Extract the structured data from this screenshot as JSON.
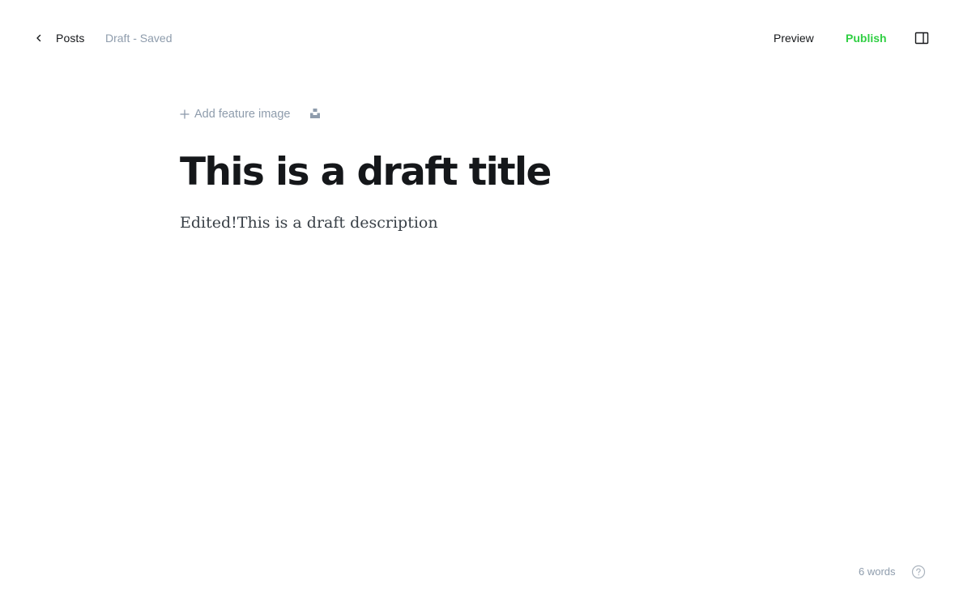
{
  "header": {
    "back_label": "Posts",
    "status": "Draft - Saved",
    "preview_label": "Preview",
    "publish_label": "Publish"
  },
  "editor": {
    "add_feature_image_label": "Add feature image",
    "title": "This is a draft title",
    "description": "Edited!This is a draft description"
  },
  "footer": {
    "word_count": "6 words"
  },
  "icons": {
    "back": "chevron-left-icon",
    "sidebar": "sidebar-toggle-icon",
    "plus": "plus-icon",
    "unsplash": "unsplash-icon",
    "help": "help-circle-icon"
  },
  "colors": {
    "publish": "#30cf43",
    "muted": "#8e9cac",
    "text": "#15171a"
  }
}
